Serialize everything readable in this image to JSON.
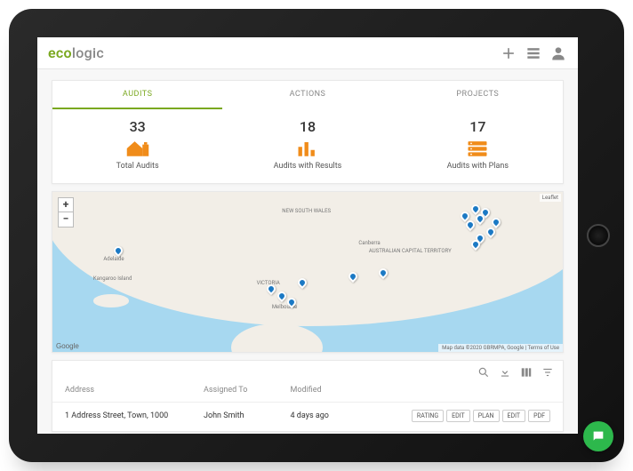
{
  "brand": {
    "part1": "eco",
    "part2": "logic"
  },
  "tabs": [
    {
      "label": "AUDITS",
      "active": true
    },
    {
      "label": "ACTIONS",
      "active": false
    },
    {
      "label": "PROJECTS",
      "active": false
    }
  ],
  "stats": [
    {
      "value": "33",
      "label": "Total Audits",
      "icon": "house"
    },
    {
      "value": "18",
      "label": "Audits with Results",
      "icon": "bars"
    },
    {
      "value": "17",
      "label": "Audits with Plans",
      "icon": "stack"
    }
  ],
  "map": {
    "labels": {
      "nsw": "NEW SOUTH WALES",
      "vic": "VICTORIA",
      "act": "AUSTRALIAN CAPITAL TERRITORY",
      "canberra": "Canberra",
      "melbourne": "Melbourne",
      "adelaide": "Adelaide",
      "kangaroo": "Kangaroo Island"
    },
    "attrib": "Map data ©2020 GBRMPA, Google | Terms of Use",
    "leaflet": "Leaflet",
    "google": "Google"
  },
  "table": {
    "headers": {
      "address": "Address",
      "assigned": "Assigned To",
      "modified": "Modified"
    },
    "row": {
      "address": "1 Address Street, Town, 1000",
      "assigned": "John Smith",
      "modified": "4 days ago",
      "actions": [
        "RATING",
        "EDIT",
        "PLAN",
        "EDIT",
        "PDF"
      ]
    }
  }
}
